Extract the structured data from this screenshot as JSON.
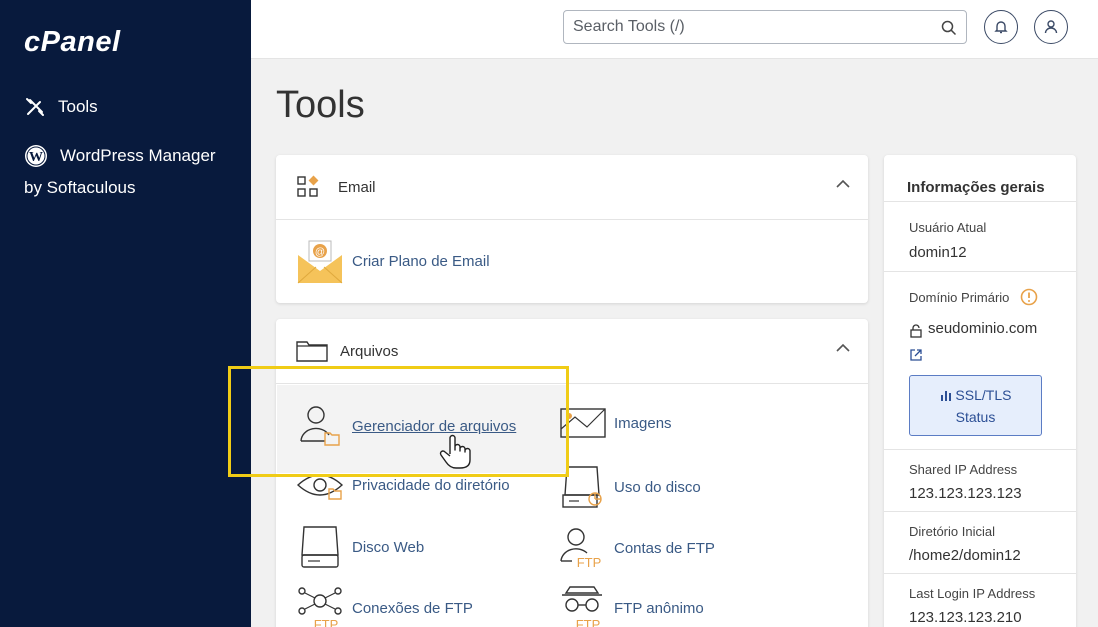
{
  "sidebar": {
    "logo": "cPanel",
    "items": [
      {
        "label": "Tools"
      },
      {
        "label": "WordPress Manager"
      }
    ],
    "wp_sub": "by Softaculous"
  },
  "header": {
    "search_placeholder": "Search Tools (/)"
  },
  "page_title": "Tools",
  "email_panel": {
    "title": "Email",
    "tools": [
      {
        "label": "Criar Plano de Email",
        "icon": "envelope-at-icon"
      }
    ]
  },
  "files_panel": {
    "title": "Arquivos",
    "tools": [
      {
        "label": "Gerenciador de arquivos",
        "icon": "file-manager-icon"
      },
      {
        "label": "Imagens",
        "icon": "images-icon"
      },
      {
        "label": "Privacidade do diretório",
        "icon": "eye-icon"
      },
      {
        "label": "Uso do disco",
        "icon": "disk-usage-icon"
      },
      {
        "label": "Disco Web",
        "icon": "web-disk-icon"
      },
      {
        "label": "Contas de FTP",
        "icon": "ftp-accounts-icon"
      },
      {
        "label": "Conexões de FTP",
        "icon": "ftp-connections-icon"
      },
      {
        "label": "FTP anônimo",
        "icon": "ftp-anonymous-icon"
      }
    ],
    "ftp_tag": "FTP"
  },
  "info": {
    "title": "Informações gerais",
    "current_user_label": "Usuário Atual",
    "current_user": "domin12",
    "primary_domain_label": "Domínio Primário",
    "primary_domain": "seudominio.com",
    "ssl_line1": "SSL/TLS",
    "ssl_line2": "Status",
    "shared_ip_label": "Shared IP Address",
    "shared_ip": "123.123.123.123",
    "home_dir_label": "Diretório Inicial",
    "home_dir": "/home2/domin12",
    "last_login_label": "Last Login IP Address",
    "last_login": "123.123.123.210"
  },
  "colors": {
    "sidebar_bg": "#081a3d",
    "link": "#3a5a85",
    "accent_orange": "#e8a24a",
    "highlight": "#f0cc16"
  }
}
